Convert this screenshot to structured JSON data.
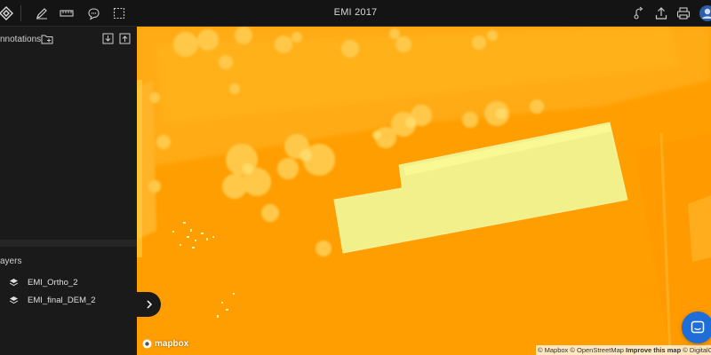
{
  "app": {
    "title": "EMI 2017"
  },
  "toolbar": {
    "left_icons": [
      "logo-icon",
      "pencil-icon",
      "ruler-icon",
      "comment-icon",
      "selection-icon"
    ],
    "right_icons": [
      "share-icon",
      "export-icon",
      "print-icon",
      "avatar"
    ]
  },
  "sidebar": {
    "annotations_label": "nnotations",
    "layers_label": "ayers",
    "layers": [
      {
        "name": "EMI_Ortho_2"
      },
      {
        "name": "EMI_final_DEM_2"
      }
    ]
  },
  "map": {
    "logo_text": "mapbox",
    "attribution": {
      "mapbox": "© Mapbox",
      "osm": "© OpenStreetMap",
      "improve": "Improve this map",
      "digitalglobe": "© DigitalG"
    }
  },
  "colors": {
    "map_base": "#ff9f00",
    "building": "#f2f08a",
    "chat_button": "#1f6dd9"
  }
}
